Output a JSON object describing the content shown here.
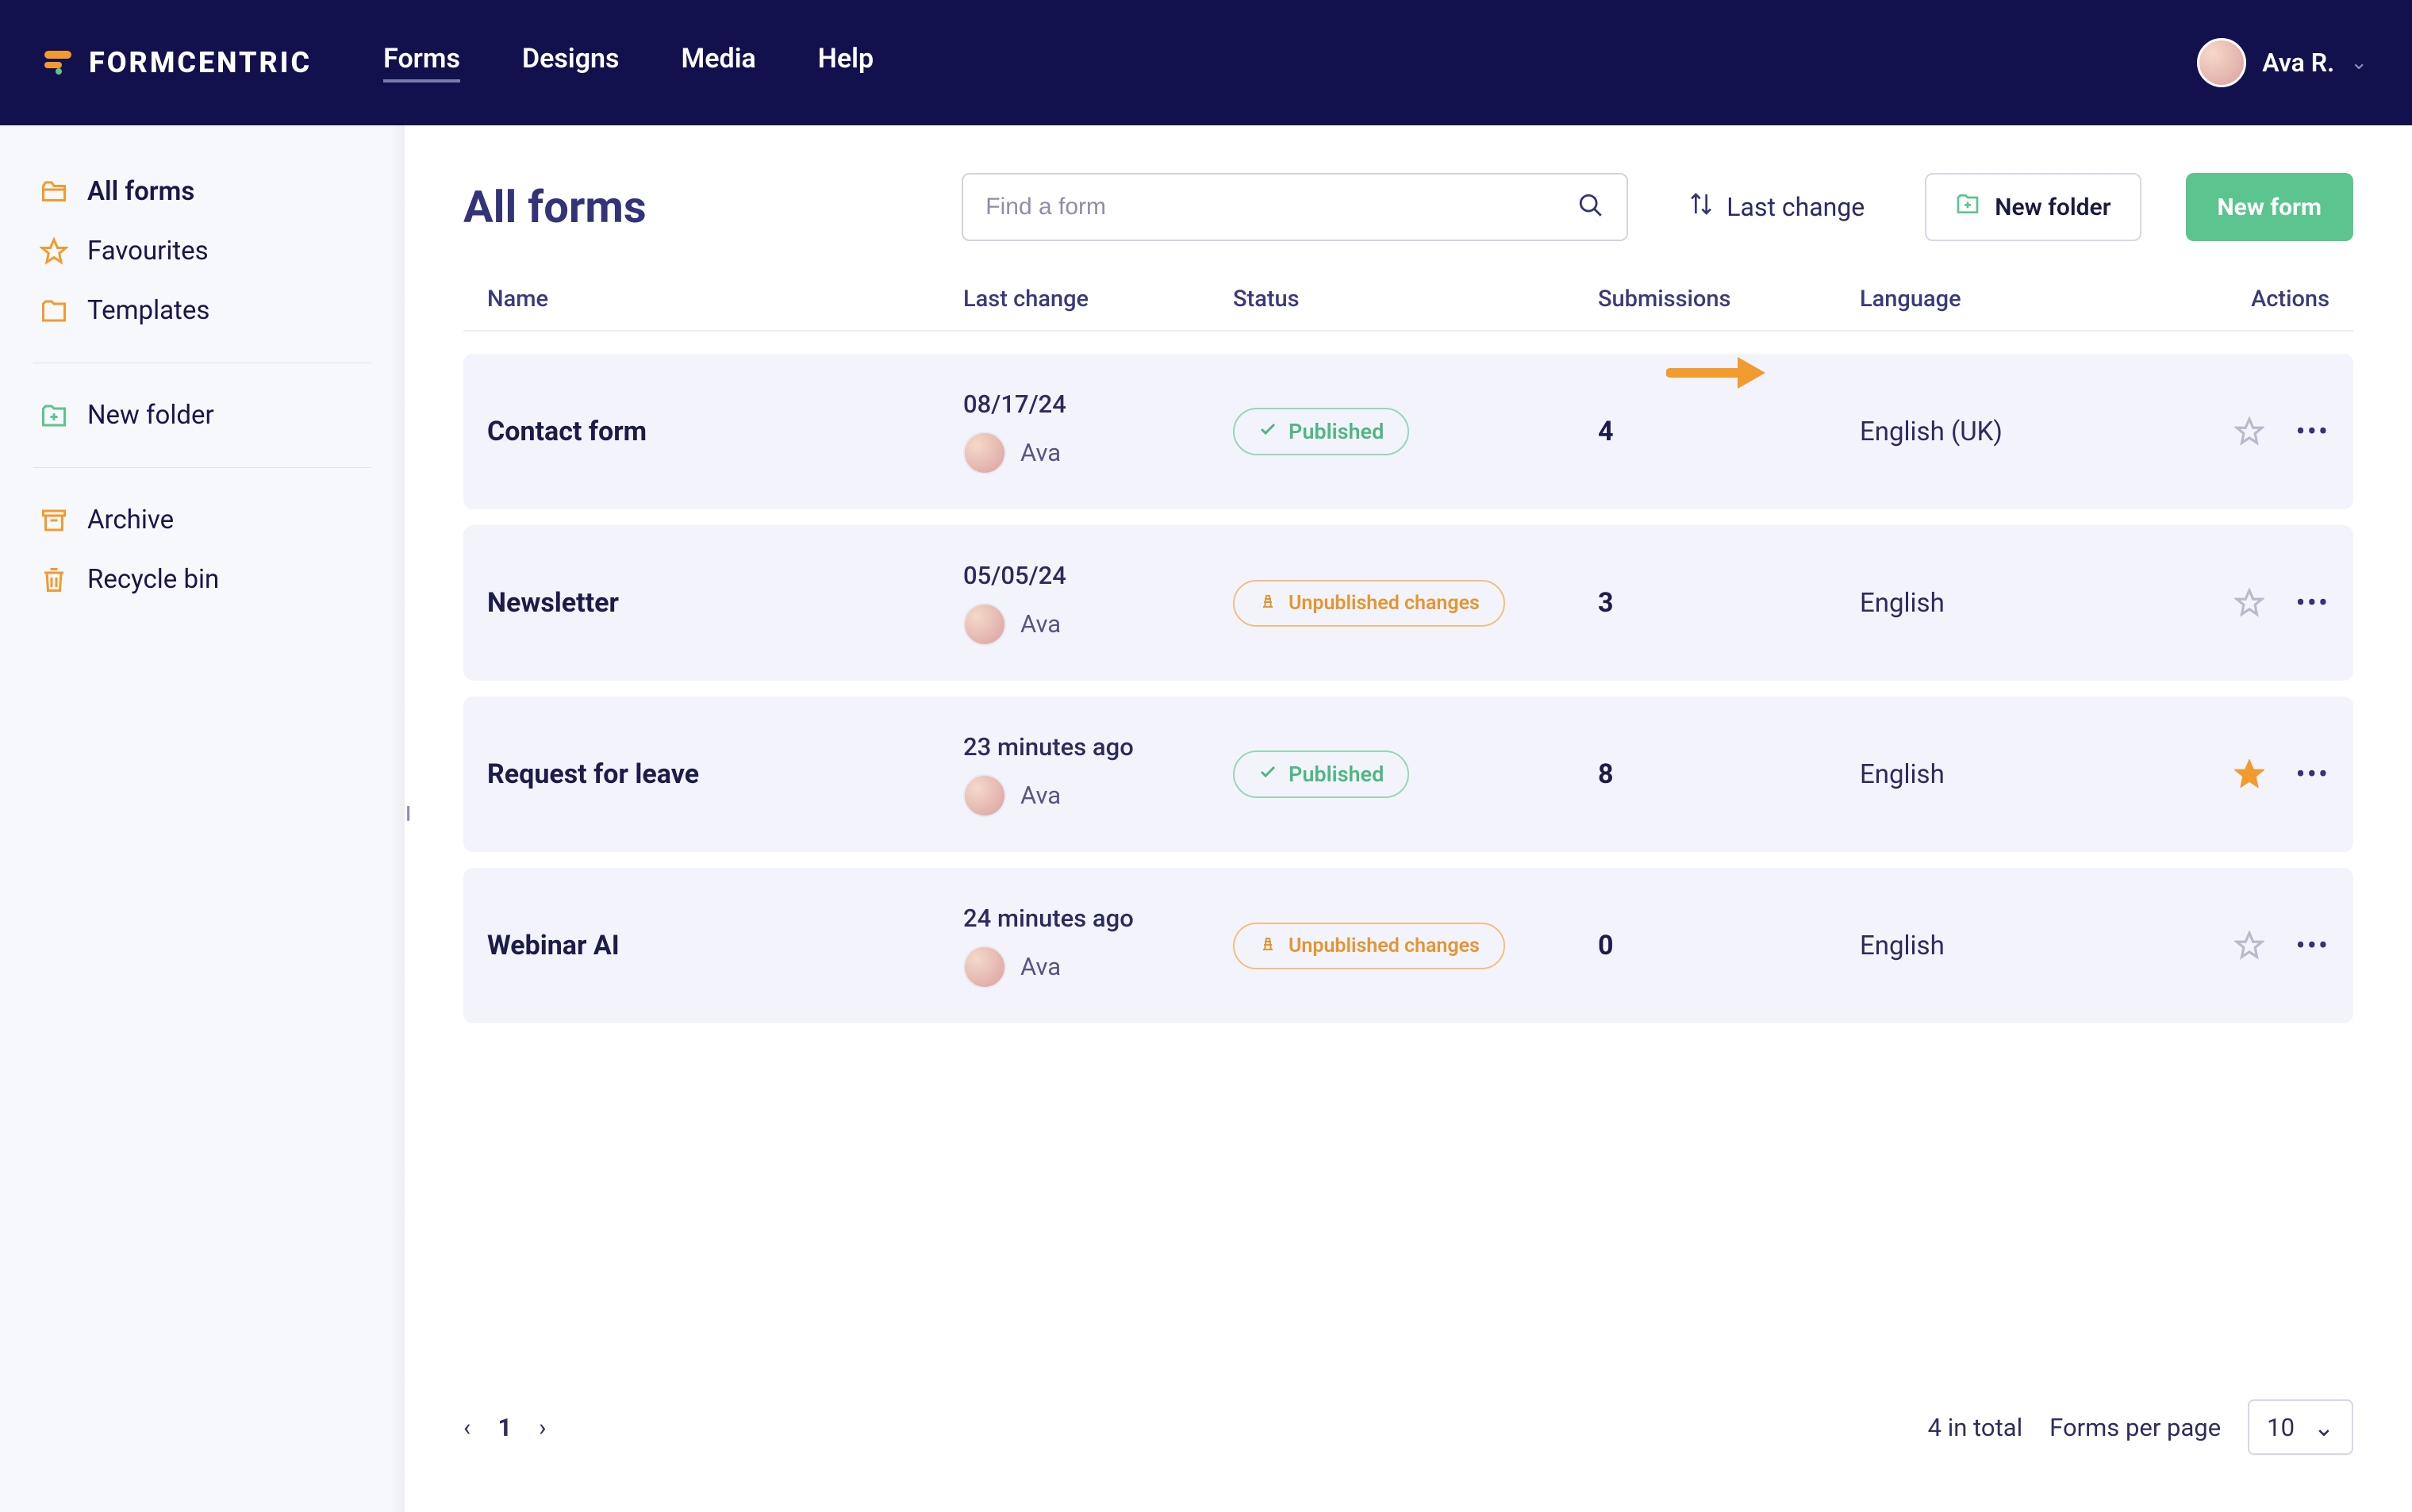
{
  "brand": "FORMCENTRIC",
  "nav": {
    "forms": "Forms",
    "designs": "Designs",
    "media": "Media",
    "help": "Help"
  },
  "user": {
    "name": "Ava R."
  },
  "sidebar": {
    "all_forms": "All forms",
    "favourites": "Favourites",
    "templates": "Templates",
    "new_folder": "New folder",
    "archive": "Archive",
    "recycle_bin": "Recycle bin"
  },
  "page_title": "All forms",
  "search_placeholder": "Find a form",
  "sort_label": "Last change",
  "new_folder_btn": "New folder",
  "new_form_btn": "New form",
  "columns": {
    "name": "Name",
    "last_change": "Last change",
    "status": "Status",
    "submissions": "Submissions",
    "language": "Language",
    "actions": "Actions"
  },
  "status_labels": {
    "published": "Published",
    "unpublished": "Unpublished changes"
  },
  "rows": [
    {
      "name": "Contact form",
      "date": "08/17/24",
      "author": "Ava",
      "status": "published",
      "submissions": "4",
      "language": "English (UK)",
      "fav": false
    },
    {
      "name": "Newsletter",
      "date": "05/05/24",
      "author": "Ava",
      "status": "unpublished",
      "submissions": "3",
      "language": "English",
      "fav": false
    },
    {
      "name": "Request for leave",
      "date": "23 minutes ago",
      "author": "Ava",
      "status": "published",
      "submissions": "8",
      "language": "English",
      "fav": true
    },
    {
      "name": "Webinar AI",
      "date": "24 minutes ago",
      "author": "Ava",
      "status": "unpublished",
      "submissions": "0",
      "language": "English",
      "fav": false
    }
  ],
  "pagination": {
    "page": "1",
    "total_text": "4 in total",
    "per_page_label": "Forms per page",
    "per_page_value": "10"
  }
}
